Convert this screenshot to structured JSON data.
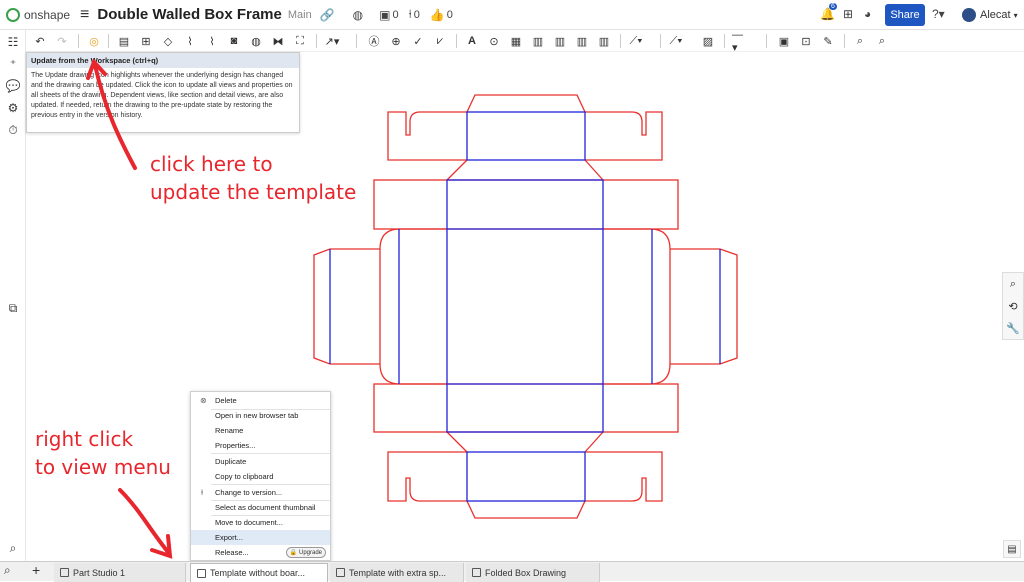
{
  "topbar": {
    "logo_text": "onshape",
    "doc_title": "Double Walled Box Frame",
    "branch": "Main",
    "counts": [
      "0",
      "0",
      "0"
    ],
    "share_label": "Share",
    "notif_count": "6",
    "user_name": "Alecat"
  },
  "tooltip": {
    "title": "Update from the Workspace (ctrl+q)",
    "body": "The Update drawing icon highlights whenever the underlying design has changed and the drawing can be updated. Click the icon to update all views and properties on all sheets of the drawing. Dependent views, like section and detail views, are also updated. If needed, return the drawing to the pre-update state by restoring the previous entry in the version history."
  },
  "annotations": {
    "update_line1": "click here to",
    "update_line2": "update the template",
    "menu_line1": "right click",
    "menu_line2": "to view menu"
  },
  "context_menu": {
    "delete": "Delete",
    "open_new_tab": "Open in new browser tab",
    "rename": "Rename",
    "properties": "Properties...",
    "duplicate": "Duplicate",
    "copy_clipboard": "Copy to clipboard",
    "change_version": "Change to version...",
    "select_thumbnail": "Select as document thumbnail",
    "move_document": "Move to document...",
    "export": "Export...",
    "release": "Release...",
    "upgrade_badge": "Upgrade"
  },
  "tabs": [
    "Part Studio 1",
    "Template without boar...",
    "Template with extra sp...",
    "Folded Box Drawing"
  ],
  "colors": {
    "outline": "#e8312c",
    "fold": "#2323d9",
    "annotation": "#e8262d",
    "share": "#1f57c2"
  }
}
